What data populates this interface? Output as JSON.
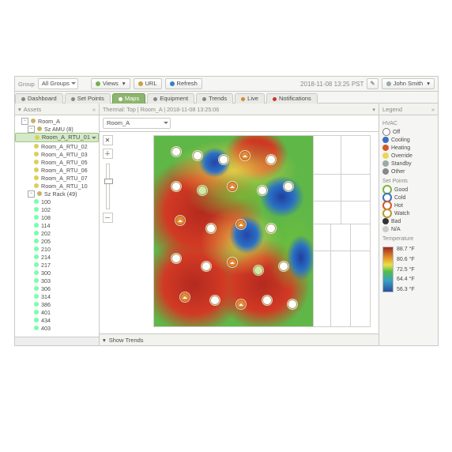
{
  "topbar": {
    "group_label": "Group",
    "group_value": "All Groups",
    "views": "Views",
    "url": "URL",
    "refresh": "Refresh",
    "timestamp": "2018-11-08 13:25 PST",
    "user": "John Smith"
  },
  "tabs": {
    "dashboard": "Dashboard",
    "set_points": "Set Points",
    "maps": "Maps",
    "equipment": "Equipment",
    "trends": "Trends",
    "live": "Live",
    "notifications": "Notifications"
  },
  "assets_panel": {
    "title": "Assets",
    "root": "Room_A",
    "amu_group": "Sz AMU (8)",
    "rtus": [
      "Room_A_RTU_01",
      "Room_A_RTU_02",
      "Room_A_RTU_03",
      "Room_A_RTU_05",
      "Room_A_RTU_06",
      "Room_A_RTU_07",
      "Room_A_RTU_10"
    ],
    "rtu_selected_index": 0,
    "rack_group": "Sz Rack (49)",
    "racks": [
      "100",
      "102",
      "108",
      "114",
      "202",
      "205",
      "210",
      "214",
      "217",
      "300",
      "303",
      "306",
      "314",
      "386",
      "401",
      "434",
      "403"
    ]
  },
  "map_panel": {
    "breadcrumb": "Thermal: Top | Room_A | 2018-11-08 13:25:06",
    "map_select": "Room_A",
    "show_trends": "Show Trends"
  },
  "map_tools": {
    "close_sym": "✕",
    "plus_sym": "＋",
    "minus_sym": "－"
  },
  "legend": {
    "title": "Legend",
    "hvac_title": "HVAC",
    "hvac": {
      "off": "Off",
      "cooling": "Cooling",
      "heating": "Heating",
      "override": "Override",
      "standby": "Standby",
      "other": "Other"
    },
    "sp_title": "Set Points",
    "sp": {
      "good": "Good",
      "cold": "Cold",
      "hot": "Hot",
      "watch": "Watch",
      "bad": "Bad",
      "na": "N/A"
    },
    "temp_title": "Temperature",
    "temp": {
      "t1": "88.7 °F",
      "t2": "80.6 °F",
      "t3": "72.5 °F",
      "t4": "64.4 °F",
      "t5": "56.3 °F"
    }
  }
}
